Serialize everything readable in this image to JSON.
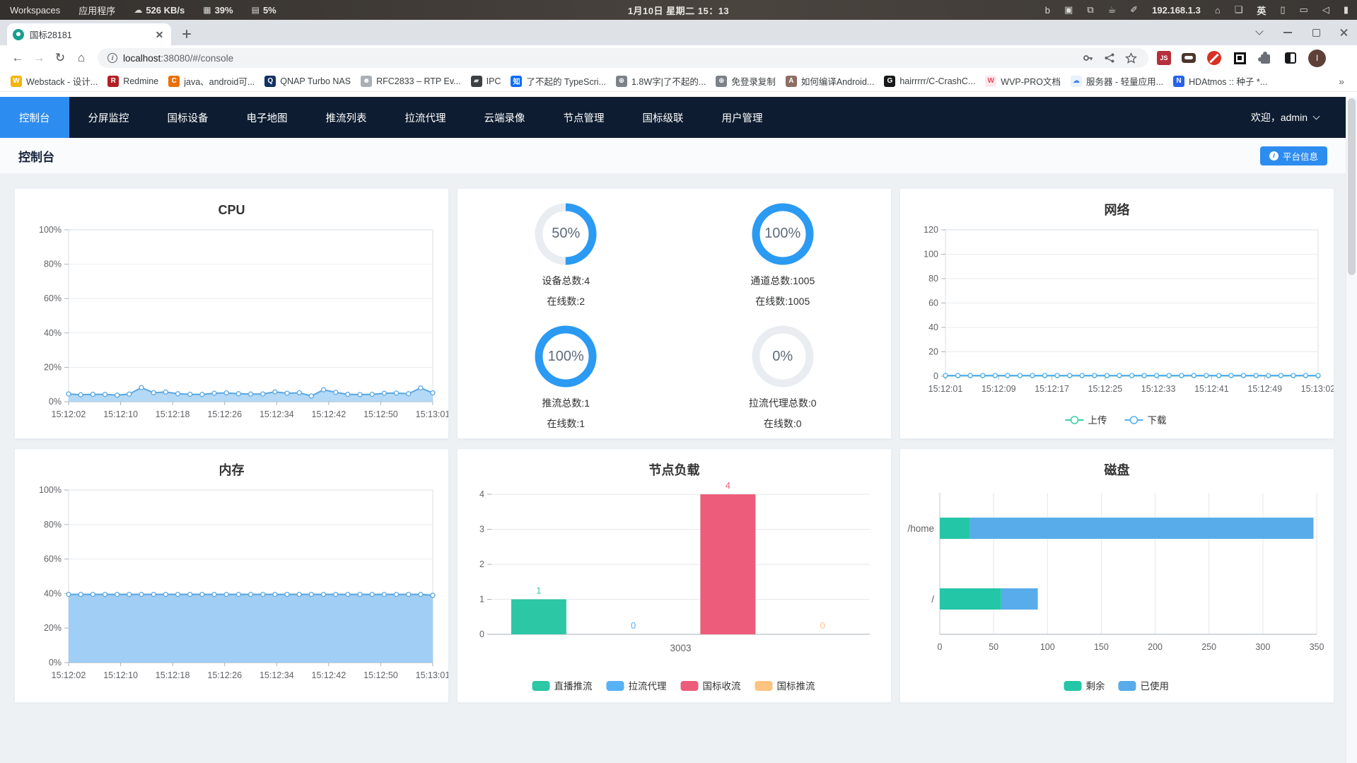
{
  "osbar": {
    "menus": [
      {
        "label": "Workspaces"
      },
      {
        "label": "应用程序"
      }
    ],
    "icons": {
      "cloud": "☁",
      "cpu": "▦",
      "mem": "▤"
    },
    "net_rate": "526 KB/s",
    "cpu_pct": "39%",
    "mem_pct": "5%",
    "clock": "1月10日 星期二 15：13",
    "right": [
      {
        "name": "bing-icon",
        "glyph": "b"
      },
      {
        "name": "screenshot-tool-icon",
        "glyph": "▣"
      },
      {
        "name": "clipboard-icon",
        "glyph": "⧉"
      },
      {
        "name": "caffeine-icon",
        "glyph": "☕"
      },
      {
        "name": "color-picker-icon",
        "glyph": "✐"
      },
      {
        "name": "ip-address-indicator",
        "text": "192.168.1.3"
      },
      {
        "name": "home-icon",
        "glyph": "⌂"
      },
      {
        "name": "workspace-switcher-icon",
        "glyph": "❏"
      },
      {
        "name": "input-method-indicator",
        "text": "英"
      },
      {
        "name": "phone-link-icon",
        "glyph": "▯"
      },
      {
        "name": "display-icon",
        "glyph": "▭"
      },
      {
        "name": "volume-icon",
        "glyph": "◁"
      },
      {
        "name": "battery-icon",
        "glyph": "▮"
      }
    ]
  },
  "browser": {
    "tab_title": "国标28181",
    "url_info_glyph": "i",
    "url_host": "localhost",
    "url_rest": ":38080/#/console",
    "toolbar_icons": [
      {
        "name": "back-icon",
        "glyph": "←",
        "dim": false
      },
      {
        "name": "forward-icon",
        "glyph": "→",
        "dim": true
      },
      {
        "name": "reload-icon",
        "glyph": "↻",
        "dim": false
      },
      {
        "name": "browser-home-icon",
        "glyph": "⌂",
        "dim": false
      }
    ],
    "ext_js_label": "JS",
    "avatar_letter": "I"
  },
  "bookmarks": {
    "overflow": "»",
    "items": [
      {
        "label": "Webstack - 设计...",
        "icon": {
          "name": "webstack-favicon",
          "glyph": "W",
          "bg": "#f2b50d",
          "fg": "#ffffff"
        }
      },
      {
        "label": "Redmine",
        "icon": {
          "name": "redmine-favicon",
          "glyph": "R",
          "bg": "#b32024",
          "fg": "#ffffff"
        }
      },
      {
        "label": "java、android可...",
        "icon": {
          "name": "csdn-favicon",
          "glyph": "C",
          "bg": "#e8710a",
          "fg": "#ffffff"
        }
      },
      {
        "label": "QNAP Turbo NAS",
        "icon": {
          "name": "qnap-favicon",
          "glyph": "Q",
          "bg": "#123262",
          "fg": "#ffffff"
        }
      },
      {
        "label": "RFC2833 – RTP Ev...",
        "icon": {
          "name": "rfc-favicon",
          "glyph": "☻",
          "bg": "#aab0b6",
          "fg": "#ffffff"
        }
      },
      {
        "label": "IPC",
        "icon": {
          "name": "ipc-folder-icon",
          "glyph": "▰",
          "bg": "#3c4043",
          "fg": "#d7d9dc"
        }
      },
      {
        "label": "了不起的 TypeScri...",
        "icon": {
          "name": "zhihu-favicon",
          "glyph": "知",
          "bg": "#0a6cff",
          "fg": "#ffffff"
        }
      },
      {
        "label": "1.8W字|了不起的...",
        "icon": {
          "name": "globe-favicon",
          "glyph": "⊕",
          "bg": "#7c8288",
          "fg": "#ffffff"
        }
      },
      {
        "label": "免登录复制",
        "icon": {
          "name": "globe-favicon",
          "glyph": "⊕",
          "bg": "#7c8288",
          "fg": "#ffffff"
        }
      },
      {
        "label": "如何编译Android...",
        "icon": {
          "name": "android-favicon",
          "glyph": "A",
          "bg": "#8d6e63",
          "fg": "#ffffff"
        }
      },
      {
        "label": "hairrrrr/C-CrashC...",
        "icon": {
          "name": "github-favicon",
          "glyph": "G",
          "bg": "#16181a",
          "fg": "#ffffff"
        }
      },
      {
        "label": "WVP-PRO文档",
        "icon": {
          "name": "wvp-favicon",
          "glyph": "W",
          "bg": "#fde8ec",
          "fg": "#e5485e"
        }
      },
      {
        "label": "服务器 - 轻量应用...",
        "icon": {
          "name": "cloud-favicon",
          "glyph": "☁",
          "bg": "#e8f1fe",
          "fg": "#3b82f6"
        }
      },
      {
        "label": "HDAtmos :: 种子 *...",
        "icon": {
          "name": "hdatmos-favicon",
          "glyph": "N",
          "bg": "#2563eb",
          "fg": "#ffffff"
        }
      }
    ]
  },
  "nav": {
    "welcome": "欢迎，admin",
    "items": [
      {
        "id": "console",
        "label": "控制台",
        "active": true
      },
      {
        "id": "split-monitor",
        "label": "分屏监控",
        "active": false
      },
      {
        "id": "gb-device",
        "label": "国标设备",
        "active": false
      },
      {
        "id": "e-map",
        "label": "电子地图",
        "active": false
      },
      {
        "id": "push-list",
        "label": "推流列表",
        "active": false
      },
      {
        "id": "pull-proxy",
        "label": "拉流代理",
        "active": false
      },
      {
        "id": "cloud-record",
        "label": "云端录像",
        "active": false
      },
      {
        "id": "node-manage",
        "label": "节点管理",
        "active": false
      },
      {
        "id": "gb-cascade",
        "label": "国标级联",
        "active": false
      },
      {
        "id": "user-manage",
        "label": "用户管理",
        "active": false
      }
    ]
  },
  "page": {
    "title": "控制台",
    "platform_btn": "平台信息",
    "platform_btn_info_glyph": "i"
  },
  "colors": {
    "accent": "#2d8cf0",
    "ring_blue": "#2b9af3",
    "ring_track": "#e9edf2"
  },
  "stats": [
    {
      "percent": "50%",
      "value": 50,
      "line1": "设备总数:4",
      "line2": "在线数:2"
    },
    {
      "percent": "100%",
      "value": 100,
      "line1": "通道总数:1005",
      "line2": "在线数:1005"
    },
    {
      "percent": "100%",
      "value": 100,
      "line1": "推流总数:1",
      "line2": "在线数:1"
    },
    {
      "percent": "0%",
      "value": 0,
      "line1": "拉流代理总数:0",
      "line2": "在线数:0"
    }
  ],
  "chart_data": [
    {
      "type": "area",
      "title": "CPU",
      "ylim": [
        0,
        100
      ],
      "ystep": 20,
      "y_suffix": "%",
      "grid": true,
      "xlabels": [
        "15:12:02",
        "15:12:10",
        "15:12:18",
        "15:12:26",
        "15:12:34",
        "15:12:42",
        "15:12:50",
        "15:13:01"
      ],
      "series": [
        {
          "name": "CPU",
          "color": "#59a7e3",
          "fill": "#a6d2f5",
          "values": [
            4.5,
            4,
            4.3,
            4.2,
            3.8,
            4.4,
            8.2,
            5.2,
            5.6,
            4.6,
            4.3,
            4.2,
            4.9,
            5.1,
            4.6,
            4.4,
            4.5,
            5.7,
            4.9,
            5.2,
            3.3,
            6.9,
            5.4,
            4.3,
            4.1,
            4.3,
            4.9,
            5,
            4.6,
            8,
            5.1
          ]
        }
      ]
    },
    {
      "type": "line",
      "title": "网络",
      "ylim": [
        0,
        120
      ],
      "ystep": 20,
      "y_suffix": "",
      "grid": true,
      "legend_position": "bottom",
      "xlabels": [
        "15:12:01",
        "15:12:09",
        "15:12:17",
        "15:12:25",
        "15:12:33",
        "15:12:41",
        "15:12:49",
        "15:13:02"
      ],
      "series": [
        {
          "name": "上传",
          "color": "#36d1a5",
          "values": [
            0.4,
            0.4,
            0.4,
            0.4,
            0.4,
            0.4,
            0.4,
            0.4,
            0.4,
            0.4,
            0.4,
            0.4,
            0.4,
            0.4,
            0.4,
            0.4,
            0.4,
            0.4,
            0.4,
            0.4,
            0.4,
            0.4,
            0.4,
            0.4,
            0.4,
            0.4,
            0.4,
            0.4,
            0.4,
            0.4,
            0.4
          ]
        },
        {
          "name": "下载",
          "color": "#54b0f2",
          "values": [
            0.6,
            0.6,
            0.6,
            0.6,
            0.6,
            0.6,
            0.6,
            0.6,
            0.6,
            0.6,
            0.6,
            0.6,
            0.6,
            0.6,
            0.6,
            0.6,
            0.6,
            0.6,
            0.6,
            0.6,
            0.6,
            0.6,
            0.6,
            0.6,
            0.6,
            0.6,
            0.6,
            0.6,
            0.6,
            0.6,
            0.6
          ]
        }
      ]
    },
    {
      "type": "area",
      "title": "内存",
      "ylim": [
        0,
        100
      ],
      "ystep": 20,
      "y_suffix": "%",
      "grid": true,
      "xlabels": [
        "15:12:02",
        "15:12:10",
        "15:12:18",
        "15:12:26",
        "15:12:34",
        "15:12:42",
        "15:12:50",
        "15:13:01"
      ],
      "series": [
        {
          "name": "内存",
          "color": "#59a7e3",
          "fill": "#90c6f2",
          "values": [
            39.5,
            39.5,
            39.5,
            39.5,
            39.5,
            39.5,
            39.5,
            39.5,
            39.5,
            39.5,
            39.5,
            39.5,
            39.5,
            39.5,
            39.5,
            39.5,
            39.5,
            39.5,
            39.5,
            39.5,
            39.5,
            39.5,
            39.5,
            39.5,
            39.5,
            39.5,
            39.5,
            39.5,
            39.5,
            39.5,
            39
          ]
        }
      ]
    },
    {
      "type": "bar",
      "title": "节点负载",
      "ylim": [
        0,
        4
      ],
      "ystep": 1,
      "legend_position": "bottom",
      "categories": [
        "3003"
      ],
      "series": [
        {
          "name": "直播推流",
          "color": "#2cc7a5",
          "values": [
            1
          ]
        },
        {
          "name": "拉流代理",
          "color": "#57b1f5",
          "values": [
            0
          ]
        },
        {
          "name": "国标收流",
          "color": "#ee5c7b",
          "values": [
            4
          ]
        },
        {
          "name": "国标推流",
          "color": "#fdc380",
          "values": [
            0
          ]
        }
      ]
    },
    {
      "type": "hbar",
      "title": "磁盘",
      "xlim": [
        0,
        350
      ],
      "xstep": 50,
      "legend_position": "bottom",
      "categories": [
        "/home",
        "/"
      ],
      "series": [
        {
          "name": "剩余",
          "color": "#23c6a6",
          "values": [
            28,
            57
          ]
        },
        {
          "name": "已使用",
          "color": "#57ace9",
          "values": [
            319,
            34
          ]
        }
      ]
    }
  ]
}
